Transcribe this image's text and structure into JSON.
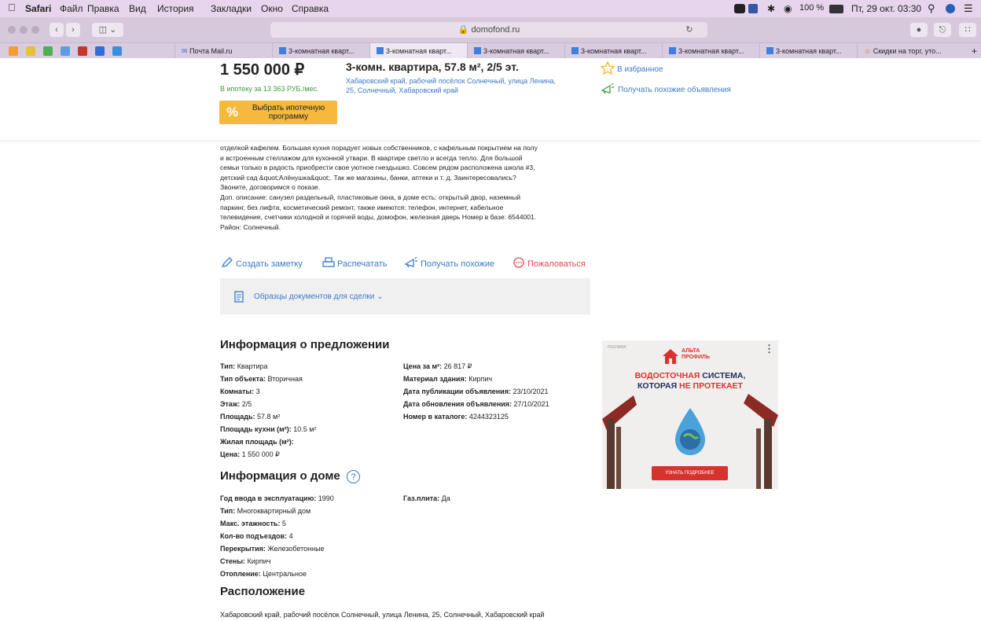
{
  "menubar": {
    "app": "Safari",
    "items": [
      "Файл",
      "Правка",
      "Вид",
      "История",
      "Закладки",
      "Окно",
      "Справка"
    ],
    "battery": "100 %",
    "datetime": "Пт, 29 окт. 03:30"
  },
  "browser": {
    "url": "domofond.ru",
    "tabs": [
      {
        "label": "Почта Mail.ru"
      },
      {
        "label": "3-комнатная кварт..."
      },
      {
        "label": "3-комнатная кварт..."
      },
      {
        "label": "3-комнатная кварт..."
      },
      {
        "label": "3-комнатная кварт..."
      },
      {
        "label": "3-комнатная кварт..."
      },
      {
        "label": "3-комнатная кварт..."
      },
      {
        "label": "Скидки на торг, уто..."
      }
    ]
  },
  "listing": {
    "price": "1 550 000 ₽",
    "mortgage_text": "В ипотеку за 13 363 РУБ./мес.",
    "mortgage_button": "Выбрать ипотечную программу",
    "title": "3-комн. квартира, 57.8 м², 2/5 эт.",
    "address": "Хабаровский край, рабочий посёлок Солнечный, улица Ленина, 25, Солнечный, Хабаровский край",
    "favorite": "В избранное",
    "similar": "Получать похожие объявления"
  },
  "description": {
    "lines": [
      "отделкой кафелем. Большая кухня порадует новых собственников, с кафельным покрытием на полу",
      "и встроенным стеллажом для кухонной утвари. В квартире светло и всегда тепло. Для большой",
      "семьи только в радость приобрести свое уютное гнездышко. Совсем рядом расположена школа #3,",
      "детский сад &quot;Алёнушка&quot;. Так же магазины, банки, аптеки и т. д. Заинтересовались?",
      "Звоните, договоримся о показе.",
      "Доп. описание: санузел раздельный, пластиковые окна, в доме есть: открытый двор, наземный",
      "паркинг, без лифта, косметический ремонт, также имеются: телефон, интернет, кабельное",
      "телевидение, счетчики холодной и горячей воды, домофон, железная дверь Номер в базе: 6544001.",
      "Район: Солнечный."
    ]
  },
  "actions": {
    "note": "Создать заметку",
    "print": "Распечатать",
    "similar": "Получать похожие",
    "report": "Пожаловаться"
  },
  "docs": {
    "label": "Образцы документов для сделки"
  },
  "offer": {
    "heading": "Информация о предложении",
    "left": [
      {
        "k": "Тип:",
        "v": " Квартира"
      },
      {
        "k": "Тип объекта:",
        "v": " Вторичная"
      },
      {
        "k": "Комнаты:",
        "v": " 3"
      },
      {
        "k": "Этаж:",
        "v": " 2/5"
      },
      {
        "k": "Площадь:",
        "v": " 57.8 м²"
      },
      {
        "k": "Площадь кухни (м²):",
        "v": " 10.5 м²"
      },
      {
        "k": "Жилая площадь (м²):",
        "v": ""
      },
      {
        "k": "Цена:",
        "v": " 1 550 000 ₽"
      }
    ],
    "right": [
      {
        "k": "Цена за м²:",
        "v": " 26 817 ₽"
      },
      {
        "k": "Материал здания:",
        "v": " Кирпич"
      },
      {
        "k": "Дата публикации объявления:",
        "v": " 23/10/2021"
      },
      {
        "k": "Дата обновления объявления:",
        "v": " 27/10/2021"
      },
      {
        "k": "Номер в каталоге:",
        "v": " 4244323125"
      }
    ]
  },
  "house": {
    "heading": "Информация о доме",
    "help": "?",
    "left": [
      {
        "k": "Год ввода в эксплуатацию:",
        "v": " 1990"
      },
      {
        "k": "Тип:",
        "v": " Многоквартирный дом"
      },
      {
        "k": "Макс. этажность:",
        "v": " 5"
      },
      {
        "k": "Кол-во подъездов:",
        "v": " 4"
      },
      {
        "k": "Перекрытия:",
        "v": " Железобетонные"
      },
      {
        "k": "Стены:",
        "v": " Кирпич"
      },
      {
        "k": "Отопление:",
        "v": " Центральное"
      }
    ],
    "right": [
      {
        "k": "Газ.плита:",
        "v": " Да"
      }
    ]
  },
  "location": {
    "heading": "Расположение",
    "address": "Хабаровский край, рабочий посёлок Солнечный, улица Ленина, 25, Солнечный, Хабаровский край"
  },
  "ad": {
    "label": "РЕКЛАМА",
    "brand1": "АЛЬТА",
    "brand2": "ПРОФИЛЬ",
    "headline1a": "ВОДОСТОЧНАЯ ",
    "headline1b": "СИСТЕМА,",
    "headline2a": "КОТОРАЯ ",
    "headline2b": "НЕ ПРОТЕКАЕТ",
    "cta": "УЗНАТЬ ПОДРОБНЕЕ"
  },
  "colors": {
    "link": "#3a7ac8",
    "green": "#3a9a3a",
    "mortgage_button": "#f5b93d",
    "report": "#e04b4b",
    "ad_red": "#d8322e",
    "ad_navy": "#1d2e5c"
  }
}
